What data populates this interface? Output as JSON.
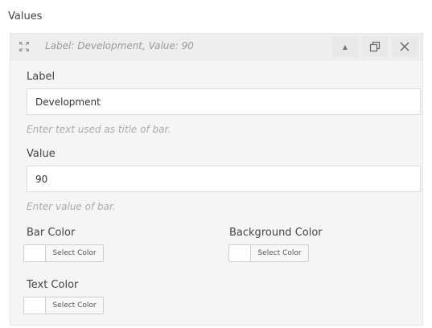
{
  "section": {
    "title": "Values"
  },
  "item": {
    "header_title": "Label: Development, Value: 90",
    "controls": {
      "collapse_icon": "triangle-up-icon",
      "duplicate_icon": "duplicate-icon",
      "close_icon": "close-icon",
      "drag_icon": "move-arrows-icon"
    }
  },
  "fields": {
    "label": {
      "title": "Label",
      "value": "Development",
      "help": "Enter text used as title of bar."
    },
    "value": {
      "title": "Value",
      "value": "90",
      "help": "Enter value of bar."
    },
    "bar_color": {
      "title": "Bar Color",
      "button": "Select Color"
    },
    "background_color": {
      "title": "Background Color",
      "button": "Select Color"
    },
    "text_color": {
      "title": "Text Color",
      "button": "Select Color"
    }
  }
}
